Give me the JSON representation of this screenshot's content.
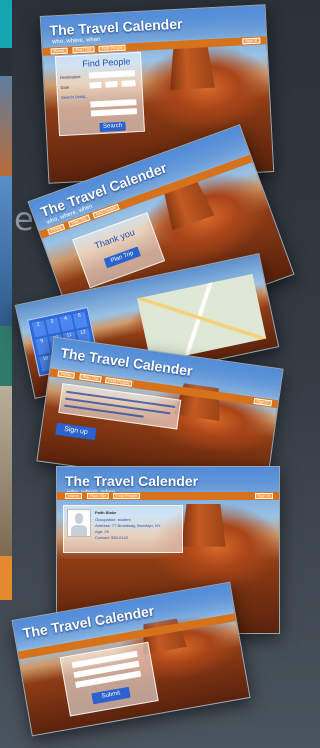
{
  "screen": {
    "ghost_text": "ens"
  },
  "app": {
    "title": "The Travel Calender",
    "tagline": "who, where, when",
    "sign_in": "Sign In"
  },
  "nav": {
    "home": "Home",
    "plan_trip": "Plan Trip",
    "find_people": "Find People"
  },
  "search_form": {
    "heading": "Find People",
    "destination_label": "Destination:",
    "date_label": "Date",
    "advanced_link": "Search Using...",
    "search_button": "Search"
  },
  "plan_trip": {
    "thank_you": "Thank you",
    "button": "Plan Trip"
  },
  "signup": {
    "button": "Sign up",
    "text_lines": 3
  },
  "profile": {
    "name": "Faith Blake",
    "lines": [
      "Occupation: student",
      "Address: 77 Broadway, Brooklyn, NY",
      "Age: 29",
      "Contact: 555-0142"
    ]
  },
  "bottom_form": {
    "button": "Submit"
  },
  "calendar_days": [
    "2",
    "3",
    "4",
    "5",
    "9",
    "10",
    "11",
    "12",
    "16",
    "17",
    "18",
    "19"
  ],
  "colors": {
    "header_blue": "#508cdc",
    "nav_orange": "#d7721c",
    "button_blue": "#2a62d0",
    "side_teal": "#17a7b3",
    "side_orange": "#e07a2a"
  }
}
